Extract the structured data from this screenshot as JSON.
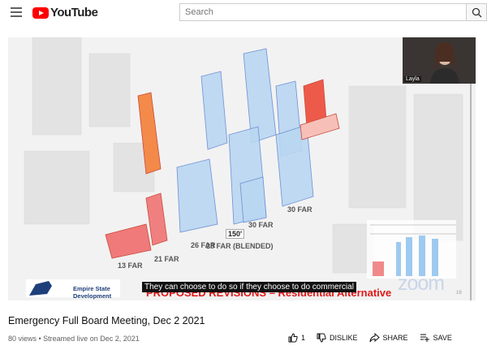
{
  "header": {
    "logo_text": "YouTube",
    "search_placeholder": "Search"
  },
  "player": {
    "webcam_name": "Layla",
    "caption": "They can choose to do so if they choose to do commercial",
    "slide_title": "PROPOSED REVISIONS – Residential Alternative",
    "agency_name": "Empire State\nDevelopment",
    "watermark": "zoom",
    "slide_number": "19",
    "far_labels": [
      "13 FAR",
      "21 FAR",
      "26 FAR",
      "150'",
      "30 FAR",
      "28 FAR (BLENDED)",
      "30 FAR"
    ]
  },
  "video": {
    "title": "Emergency Full Board Meeting, Dec 2 2021",
    "views": "80 views • Streamed live on Dec 2, 2021"
  },
  "actions": {
    "like_count": "1",
    "dislike_label": "DISLIKE",
    "share_label": "SHARE",
    "save_label": "SAVE"
  },
  "colors": {
    "youtube_red": "#ff0000",
    "building_blue": "#a9cbea",
    "building_red": "#ee6a5a",
    "slide_title_red": "#e01818"
  },
  "icons": [
    "menu-icon",
    "youtube-logo-icon",
    "search-icon",
    "thumb-up-icon",
    "thumb-down-icon",
    "share-icon",
    "save-playlist-icon"
  ]
}
